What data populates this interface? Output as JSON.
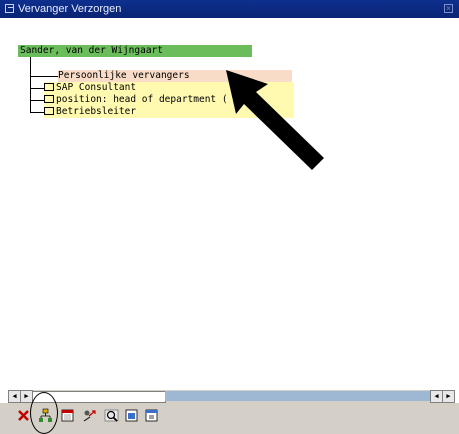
{
  "window": {
    "title": "Vervanger Verzorgen"
  },
  "tree": {
    "root": "Sander, van der Wijngaart",
    "child": "Persoonlijke vervangers",
    "items": [
      {
        "label": "SAP Consultant"
      },
      {
        "label": "position: head of department ("
      },
      {
        "label": "Betriebsleiter"
      }
    ]
  },
  "colors": {
    "titlebar": "#0d2f8e",
    "root_highlight": "#6bbd5b",
    "child_highlight": "#f8dcc8",
    "item_highlight": "#fffab0",
    "scroll_fill": "#9eb8d4"
  },
  "toolbar": {
    "buttons": [
      {
        "icon": "delete-icon"
      },
      {
        "icon": "org-structure-icon"
      },
      {
        "icon": "calendar-icon"
      },
      {
        "icon": "substitute-icon"
      },
      {
        "icon": "find-icon"
      },
      {
        "icon": "expand-icon"
      },
      {
        "icon": "collapse-icon"
      }
    ]
  }
}
